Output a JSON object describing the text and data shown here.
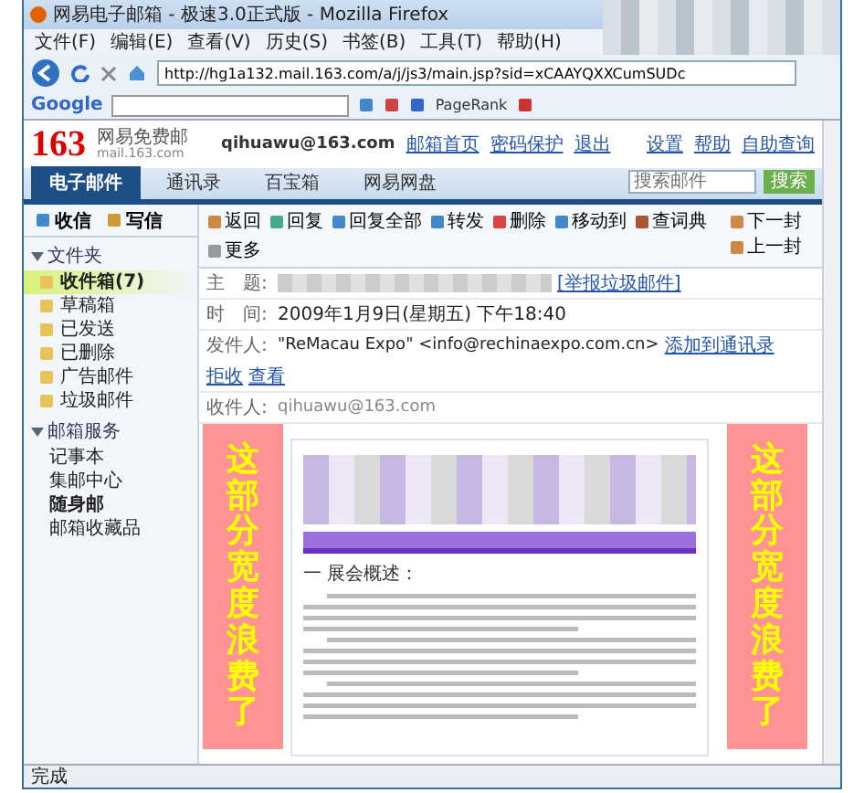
{
  "browser": {
    "title": "网易电子邮箱 - 极速3.0正式版 - Mozilla Firefox",
    "menu": [
      "文件(F)",
      "编辑(E)",
      "查看(V)",
      "历史(S)",
      "书签(B)",
      "工具(T)",
      "帮助(H)"
    ],
    "url": "http://hg1a132.mail.163.com/a/j/js3/main.jsp?sid=xCAAYQXXCumSUDc",
    "search_logo": "Google",
    "pagerank": "PageRank",
    "status": "完成"
  },
  "header": {
    "logo": "163",
    "brand": "网易免费邮",
    "domain": "mail.163.com",
    "account": "qihuawu@163.com",
    "account_links": [
      "邮箱首页",
      "密码保护",
      "退出"
    ],
    "top_links": [
      "设置",
      "帮助",
      "自助查询"
    ]
  },
  "tabs": [
    {
      "label": "电子邮件",
      "selected": true
    },
    {
      "label": "通讯录",
      "selected": false
    },
    {
      "label": "百宝箱",
      "selected": false
    },
    {
      "label": "网易网盘",
      "selected": false
    }
  ],
  "search": {
    "placeholder": "搜索邮件",
    "button": "搜索"
  },
  "compose": [
    "收信",
    "写信"
  ],
  "sidebar": [
    {
      "title": "文件夹",
      "expanded": true,
      "items": [
        {
          "label": "收件箱(7)",
          "selected": true
        },
        {
          "label": "草稿箱",
          "selected": false
        },
        {
          "label": "已发送",
          "selected": false
        },
        {
          "label": "已删除",
          "selected": false
        },
        {
          "label": "广告邮件",
          "selected": false
        },
        {
          "label": "垃圾邮件",
          "selected": false
        }
      ]
    },
    {
      "title": "邮箱服务",
      "expanded": true,
      "items": [
        {
          "label": "记事本",
          "selected": false
        },
        {
          "label": "集邮中心",
          "selected": false
        },
        {
          "label": "随身邮",
          "selected": true
        },
        {
          "label": "邮箱收藏品",
          "selected": false
        }
      ]
    }
  ],
  "toolbar": [
    "返回",
    "回复",
    "回复全部",
    "转发",
    "删除",
    "移动到",
    "查词典",
    "更多"
  ],
  "nav": [
    "下一封",
    "上一封"
  ],
  "message": {
    "subject_label": "主　题:",
    "report": "[举报垃圾邮件]",
    "time_label": "时　间:",
    "time": "2009年1月9日(星期五) 下午18:40",
    "from_label": "发件人:",
    "from": "\"ReMacau Expo\" <info@rechinaexpo.com.cn>",
    "from_actions": [
      "添加到通讯录",
      "拒收",
      "查看"
    ],
    "to_label": "收件人:",
    "to": "qihuawu@163.com",
    "heading": "一 展会概述："
  },
  "overlays": [
    "这部分宽度浪费了",
    "这部分宽度浪费了"
  ]
}
